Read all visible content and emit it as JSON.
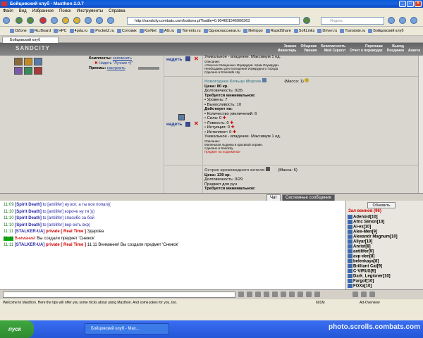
{
  "window": {
    "title": "Бойцовский клуб - Maxthon 2.0.7"
  },
  "menu": [
    "Файл",
    "Вид",
    "Избранное",
    "Поиск",
    "Инструменты",
    "Справка"
  ],
  "address": {
    "url": "http://sandcity.combats.com/buttons.pl?battle=0.904601546006363",
    "search_placeholder": "Яндекс"
  },
  "bookmarks": [
    "OZone",
    "Ru.Board",
    "НРС",
    "4pda.ru",
    "PocketZ.ru",
    "Сотовик",
    "KorNet",
    "AG.ru",
    "Torrents.ru",
    "Одноклассники.ru",
    "filehippo",
    "RapidShare",
    "SoftLinks",
    "Driver.ru",
    "Translate.ru",
    "Бойцовский клуб"
  ],
  "tab": {
    "label": "Бойцовский клуб"
  },
  "game": {
    "logo": "SANDCITY",
    "menu": [
      "Знание",
      "Общение",
      "Безопасность",
      "Персонаж",
      "Выход",
      "Инвентарь",
      "Умения",
      "Мой Скролл",
      "Отчет о переводах",
      "Поединки",
      "Анкета"
    ],
    "sets": {
      "komplekty": "Комплекты:",
      "zapomnit": "запомнить",
      "nadet_luchnik": "Надеть \"Лучник =)\"",
      "priemy": "Приемы:",
      "nastroit": "настроить"
    },
    "item1_tail": [
      "Уникальное - владение. Максимум 1 ед.",
      "Описание:",
      "«Очки из Священных Изумрудов. Храм Изумруда»",
      "Необходимы для посещения Изумрудного Города",
      "Сделано в Emeralds city"
    ],
    "item2": {
      "name": "Новогоднее Кольцо Мороза",
      "mass": "(Масса: 1)",
      "price": "Цена: 80 кр.",
      "durability": "Долговечность: 0/35",
      "req": "Требуется минимальное:",
      "req_list": [
        "• Уровень: 7",
        "• Выносливость: 10"
      ],
      "acts": "Действует на:",
      "act_list": [
        "• Количество увеличений: 6",
        "• Сила: 0",
        "• Ловкость: 0",
        "• Интуиция: 0",
        "• Интеллект: 0"
      ],
      "unique": "Уникальное - владение. Максимум 1 ед.",
      "desc_label": "Описание:",
      "desc": "Маленькая льдинка в красивой оправе.",
      "made": "Сделано в Sandcity",
      "gift": "Предмет на подземелье"
    },
    "item3": {
      "name": "Острие кровожадного вотеля",
      "mass": "(Масса: 5)",
      "price": "Цена: 139 кр.",
      "durability": "Долговечность: 0/29",
      "transfer": "Предмет для рун",
      "req": "Требуется минимальное:"
    },
    "nadet": "надеть"
  },
  "chat_tabs": {
    "chat": "Чат",
    "system": "Системные сообщения"
  },
  "chat_lines": [
    {
      "time": "11:09",
      "name": "[Spirit Death]",
      "to": "to [antilifer]",
      "msg": "ну вот, а ты все попал(("
    },
    {
      "time": "11:10",
      "name": "[Spirit Death]",
      "to": "to [antilifer]",
      "msg": "короче ну тя )))"
    },
    {
      "time": "11:10",
      "name": "[Spirit Death]",
      "to": "to [antilifer]",
      "msg": "спасибо за бой"
    },
    {
      "time": "11:10",
      "name": "[Spirit Death]",
      "to": "to [antilifer]",
      "msg": "вер ехть вкр)"
    }
  ],
  "chat_special": {
    "l5_time": "11:11",
    "l5_name": "[STALKER-UA]",
    "l5_priv": "private [ Real Time ]",
    "l5_msg": "Здарова",
    "l6_time": "11:11",
    "l6_warn": "Внимание!",
    "l6_msg": "Вы создали предмет 'Снежок'",
    "l7_time": "11:11",
    "l7_name": "[STALKER-UA]",
    "l7_priv": "private [ Real Time ]",
    "l7_msg": "11:11 Внимание! Вы создали предмет 'Снежок'"
  },
  "right_panel": {
    "refresh": "Обновить",
    "title": "Зал воинов (96)",
    "users": [
      "Adenoid[10]",
      "Afric Simon[10]",
      "Al-ex[10]",
      "Alex-Men[9]",
      "Alexandr Magnum[10]",
      "Aliyar[10]",
      "Anrist[8]",
      "antilifer[9]",
      "avp-den[8]",
      "belenkaya[8]",
      "Brilliant Cat[9]",
      "C-VIRUS[9]",
      "Dark_Legioner[10]",
      "Fargof[10]",
      "FOXa[10]"
    ]
  },
  "status": {
    "text": "Welcome to Maxthon. Here the tips will offer you some tricks about using Maxthon. And some jokes for you, too.",
    "mem": "601M",
    "adblock": "Ad-Overview"
  },
  "taskbar": {
    "start": "пуск",
    "task": "Бойцовский клуб - Max...",
    "watermark": "photo.scrolls.combats.com"
  }
}
